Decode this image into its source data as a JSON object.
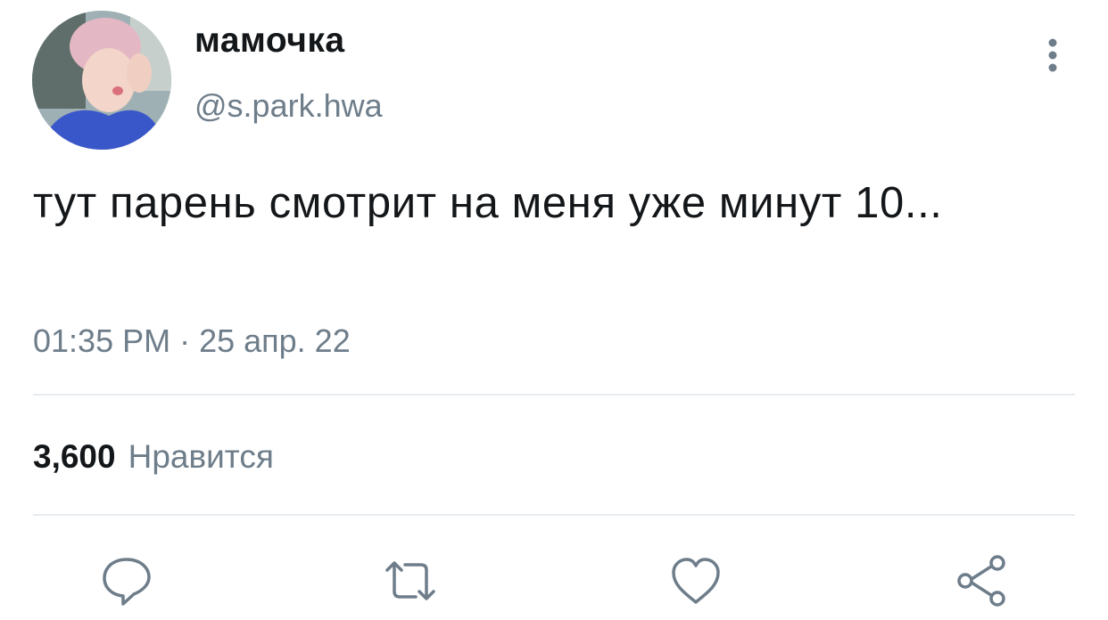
{
  "user": {
    "display_name": "мамочка",
    "handle": "@s.park.hwa"
  },
  "tweet": {
    "text": "тут парень смотрит на меня уже минут 10...",
    "timestamp": "01:35 PM · 25 апр. 22"
  },
  "stats": {
    "likes_count": "3,600",
    "likes_label": "Нравится"
  },
  "icons": {
    "more": "more-vertical-icon",
    "reply": "reply-icon",
    "retweet": "retweet-icon",
    "like": "heart-icon",
    "share": "share-icon"
  },
  "colors": {
    "text": "#14171a",
    "secondary": "#6e7d8a",
    "icon": "#6e7d8a",
    "divider": "#e6ecf0"
  }
}
